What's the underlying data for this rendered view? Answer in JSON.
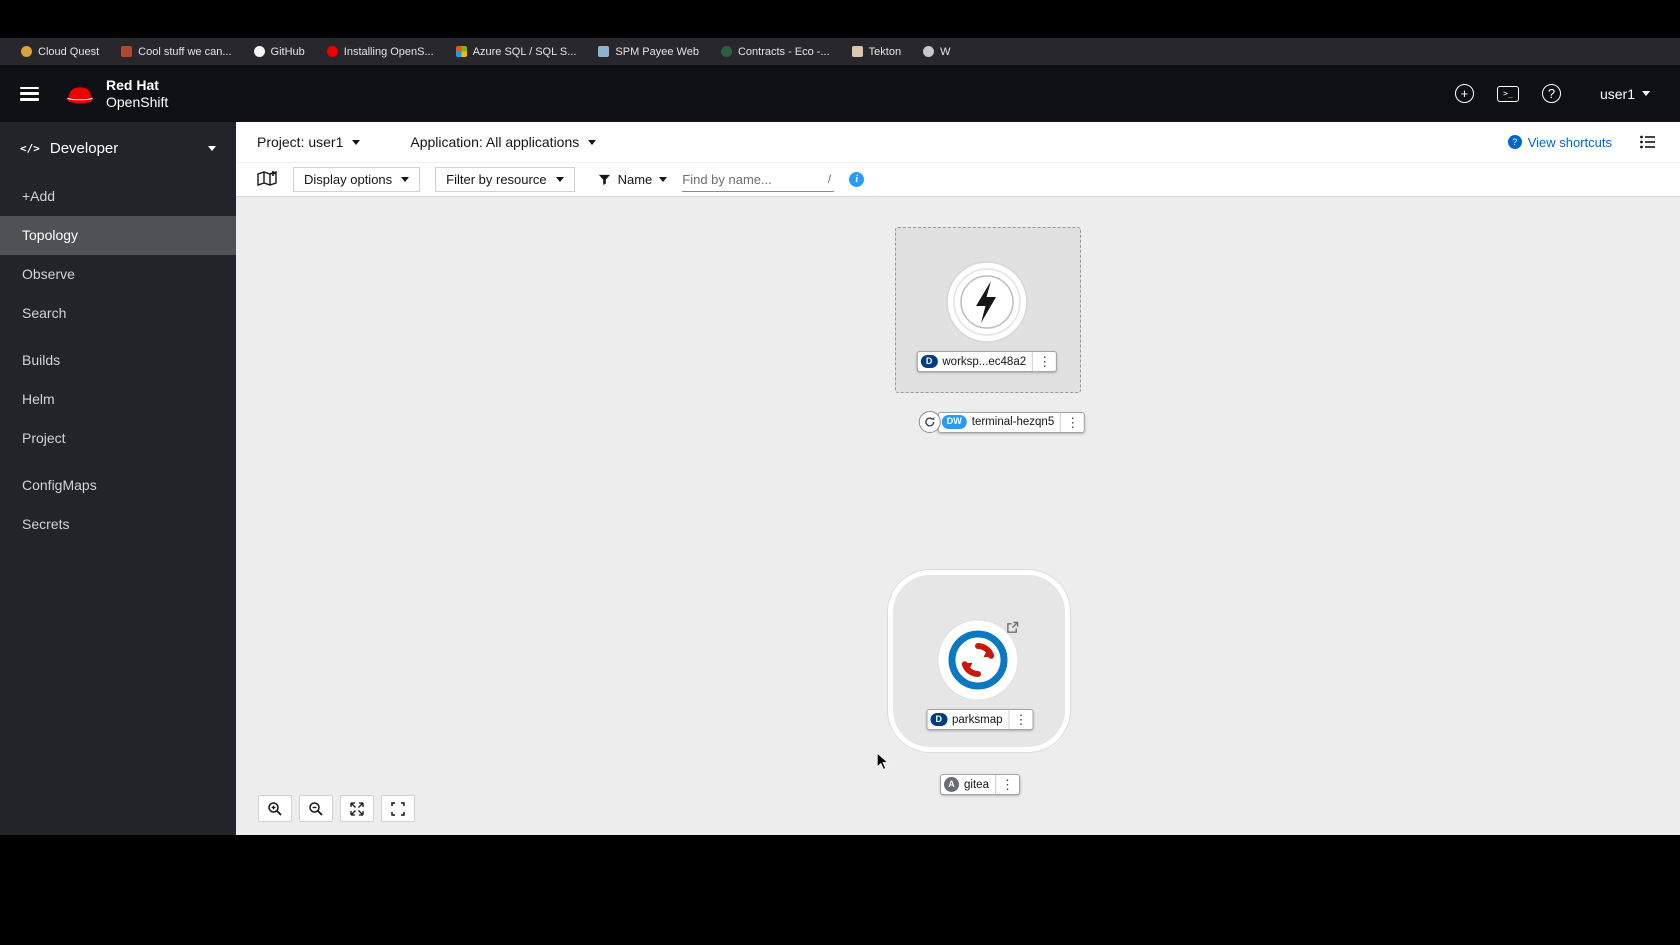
{
  "icons": {
    "kebab": "⋮",
    "plus": "+",
    "help": "?",
    "terminal_prompt": ">_",
    "info": "i",
    "code": "</>"
  },
  "bookmarks": {
    "items": [
      {
        "label": "Cloud Quest",
        "icon": "cloud-quest-favicon",
        "icon_color": "#d9a23b"
      },
      {
        "label": "Cool stuff we can...",
        "icon": "folder-favicon",
        "icon_color": "#b0492f"
      },
      {
        "label": "GitHub",
        "icon": "github-favicon",
        "icon_color": "#f5f5f5"
      },
      {
        "label": "Installing OpenS...",
        "icon": "openshift-favicon",
        "icon_color": "#ee0000"
      },
      {
        "label": "Azure SQL / SQL S...",
        "icon": "microsoft-favicon",
        "icon_colors": [
          "#f25022",
          "#7fba00",
          "#00a4ef",
          "#ffb900"
        ]
      },
      {
        "label": "SPM Payee Web",
        "icon": "spm-favicon",
        "icon_color": "#8fb3cf"
      },
      {
        "label": "Contracts - Eco -...",
        "icon": "contracts-favicon",
        "icon_color": "#2f5d45"
      },
      {
        "label": "Tekton",
        "icon": "tekton-favicon",
        "icon_color": "#d8c9ae"
      },
      {
        "label": "W",
        "icon": "globe-favicon",
        "icon_color": "#c8c8c8"
      }
    ]
  },
  "masthead": {
    "brand_top": "Red Hat",
    "brand_bottom": "OpenShift",
    "user_label": "user1"
  },
  "sidebar": {
    "perspective": "Developer",
    "items": [
      {
        "label": "+Add"
      },
      {
        "label": "Topology"
      },
      {
        "label": "Observe"
      },
      {
        "label": "Search"
      },
      {
        "label": "Builds"
      },
      {
        "label": "Helm"
      },
      {
        "label": "Project"
      },
      {
        "label": "ConfigMaps"
      },
      {
        "label": "Secrets"
      }
    ]
  },
  "context_bar": {
    "project": "Project: user1",
    "application": "Application: All applications",
    "shortcuts_label": "View shortcuts"
  },
  "toolbar": {
    "display_options": "Display options",
    "filter_by_resource": "Filter by resource",
    "name_filter": "Name",
    "find_placeholder": "Find by name...",
    "shortcut_key": "/"
  },
  "topology": {
    "nodes": [
      {
        "id": "workspace",
        "label": "worksp...ec48a2",
        "badge": "D",
        "badge_bg": "#003e7e"
      },
      {
        "id": "terminal",
        "label": "terminal-hezqn5",
        "badge": "DW",
        "badge_bg": "#2b9af3"
      },
      {
        "id": "parksmap",
        "label": "parksmap",
        "badge": "D",
        "badge_bg": "#003e7e"
      },
      {
        "id": "gitea",
        "label": "gitea",
        "badge": "A",
        "badge_bg": "#6a6e73"
      }
    ]
  },
  "colors": {
    "brand_red": "#ee0000",
    "link_blue": "#0066cc",
    "info_blue": "#2b9af3",
    "nav_active_bg": "#4f5255",
    "canvas_bg": "#ededed"
  }
}
